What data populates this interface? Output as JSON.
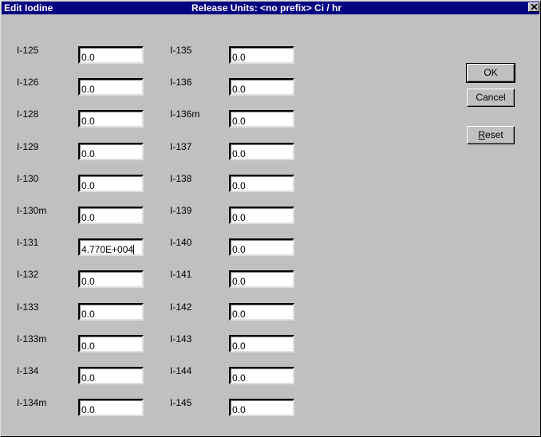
{
  "window": {
    "title": "Edit Iodine",
    "subtitle": "Release Units: <no prefix> Ci / hr",
    "close_icon": "close-icon"
  },
  "isotopes": [
    {
      "label": "I-125",
      "value": "0.0"
    },
    {
      "label": "I-126",
      "value": "0.0"
    },
    {
      "label": "I-128",
      "value": "0.0"
    },
    {
      "label": "I-129",
      "value": "0.0"
    },
    {
      "label": "I-130",
      "value": "0.0"
    },
    {
      "label": "I-130m",
      "value": "0.0"
    },
    {
      "label": "I-131",
      "value": "4.770E+004"
    },
    {
      "label": "I-132",
      "value": "0.0"
    },
    {
      "label": "I-133",
      "value": "0.0"
    },
    {
      "label": "I-133m",
      "value": "0.0"
    },
    {
      "label": "I-134",
      "value": "0.0"
    },
    {
      "label": "I-134m",
      "value": "0.0"
    },
    {
      "label": "I-135",
      "value": "0.0"
    },
    {
      "label": "I-136",
      "value": "0.0"
    },
    {
      "label": "I-136m",
      "value": "0.0"
    },
    {
      "label": "I-137",
      "value": "0.0"
    },
    {
      "label": "I-138",
      "value": "0.0"
    },
    {
      "label": "I-139",
      "value": "0.0"
    },
    {
      "label": "I-140",
      "value": "0.0"
    },
    {
      "label": "I-141",
      "value": "0.0"
    },
    {
      "label": "I-142",
      "value": "0.0"
    },
    {
      "label": "I-143",
      "value": "0.0"
    },
    {
      "label": "I-144",
      "value": "0.0"
    },
    {
      "label": "I-145",
      "value": "0.0"
    }
  ],
  "buttons": {
    "ok": "OK",
    "cancel": "Cancel",
    "reset_first": "R",
    "reset_rest": "eset"
  }
}
